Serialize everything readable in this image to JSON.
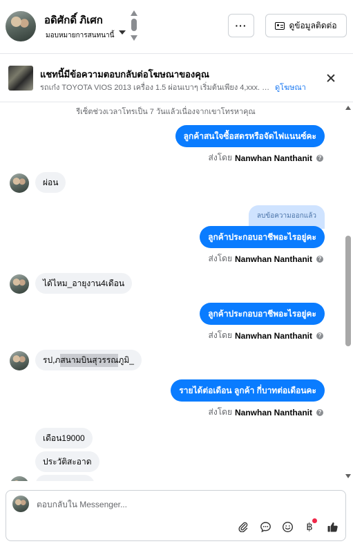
{
  "header": {
    "name": "อดิศักดิ์ ภิเศก",
    "subtitle": "มอบหมายการสนทนานี้",
    "more_label": "···",
    "contact_label": "ดูข้อมูลติดต่อ"
  },
  "ad": {
    "title": "แชทนี้มีข้อความตอบกลับต่อโฆษณาของคุณ",
    "description": "รถเก๋ง TOYOTA VIOS 2013 เครื่อง 1.5 ผ่อนเบาๆ เริ่มต้นเพียง 4,xxx. บาท เท่...",
    "view_ad": "ดูโฆษณา"
  },
  "notice": "รีเซ็ตช่วงเวลาโทรเป็น 7 วันแล้วเนื่องจากเขาโทรหาคุณ",
  "sent_by_prefix": "ส่งโดย",
  "sender": "Nanwhan Nanthanit",
  "messages": {
    "out1": "ลูกค้าสนใจซื้อสดรหรือจัดไฟแนนซ์คะ",
    "in1": "ผ่อน",
    "deleted": "ลบข้อความออกแล้ว",
    "out2": "ลูกค้าประกอบอาชีพอะไรอยู่คะ",
    "in2": "ได้ไหม_อายุงาน4เดือน",
    "out3": "ลูกค้าประกอบอาชีพอะไรอยู่คะ",
    "in3_a": "รป,ภ",
    "in3_b": "สนามบินสุวรรณ",
    "in3_c": "ภูมิ_",
    "out4": "รายได้ต่อเดือน ลูกค้า กี่บาทต่อเดือนคะ",
    "in4": "เดือน19000",
    "in5": "ประวัติสะอาด"
  },
  "composer": {
    "placeholder": "ตอบกลับใน Messenger..."
  },
  "icons": {
    "attach": "paperclip-icon",
    "chat": "chat-bubble-icon",
    "emoji": "smiley-icon",
    "payment": "baht-icon",
    "like": "thumbs-up-icon"
  },
  "colors": {
    "outgoing_bubble": "#0a7cff",
    "incoming_bubble": "#f0f2f5",
    "link": "#1877f2",
    "notification_dot": "#f02849"
  }
}
